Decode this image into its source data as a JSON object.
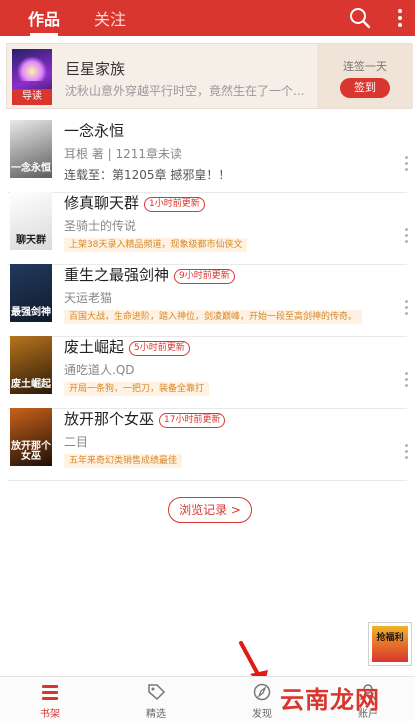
{
  "topbar": {
    "tabs": [
      {
        "label": "作品",
        "active": true
      },
      {
        "label": "关注",
        "active": false
      }
    ],
    "icons": [
      "search-icon",
      "more-vertical-icon"
    ],
    "color": "#d8362f"
  },
  "banner": {
    "cover_label": "导读",
    "title": "巨星家族",
    "desc": "沈秋山意外穿越平行时空，竟然生在了一个...",
    "sign_label": "连签一天",
    "sign_button": "签到"
  },
  "books": [
    {
      "title": "一念永恒",
      "badge": "",
      "author": "耳根 著 | 1211章未读",
      "note": "连载至：第1205章 撼邪皇！！",
      "tag": ""
    },
    {
      "title": "修真聊天群",
      "badge": "1小时前更新",
      "author": "圣骑士的传说",
      "note": "",
      "tag": "上架38天录入精品频道，现象级都市仙侠文"
    },
    {
      "title": "重生之最强剑神",
      "badge": "9小时前更新",
      "author": "天运老猫",
      "note": "",
      "tag": "百国大战，生命进阶，踏入神位，剑凌巅峰，开始一段至高剑神的传奇。"
    },
    {
      "title": "废土崛起",
      "badge": "5小时前更新",
      "author": "通吃道人.QD",
      "note": "",
      "tag": "开局一条狗，一把刀，装备全靠打"
    },
    {
      "title": "放开那个女巫",
      "badge": "17小时前更新",
      "author": "二目",
      "note": "",
      "tag": "五年来奇幻类销售成绩最佳"
    }
  ],
  "covers": [
    {
      "text": "一念永恒",
      "colors": [
        "#e9e9e9",
        "#5c5c5c"
      ]
    },
    {
      "text": "聊天群",
      "colors": [
        "#ffffff",
        "#d9d9d9"
      ]
    },
    {
      "text": "最强剑神",
      "colors": [
        "#223a5e",
        "#0f1a2b"
      ]
    },
    {
      "text": "废土崛起",
      "colors": [
        "#b8741f",
        "#2b1a08"
      ]
    },
    {
      "text": "放开那个女巫",
      "colors": [
        "#c9621c",
        "#1d0f06"
      ]
    }
  ],
  "history_button": "浏览记录 >",
  "promo": {
    "label": "抢福利"
  },
  "bottom_nav": [
    {
      "label": "书架",
      "icon": "bookshelf-icon",
      "active": true
    },
    {
      "label": "精选",
      "icon": "featured-tag-icon",
      "active": false
    },
    {
      "label": "发现",
      "icon": "compass-icon",
      "active": false
    },
    {
      "label": "账户",
      "icon": "account-icon",
      "active": false
    }
  ],
  "watermark": "云南龙网"
}
